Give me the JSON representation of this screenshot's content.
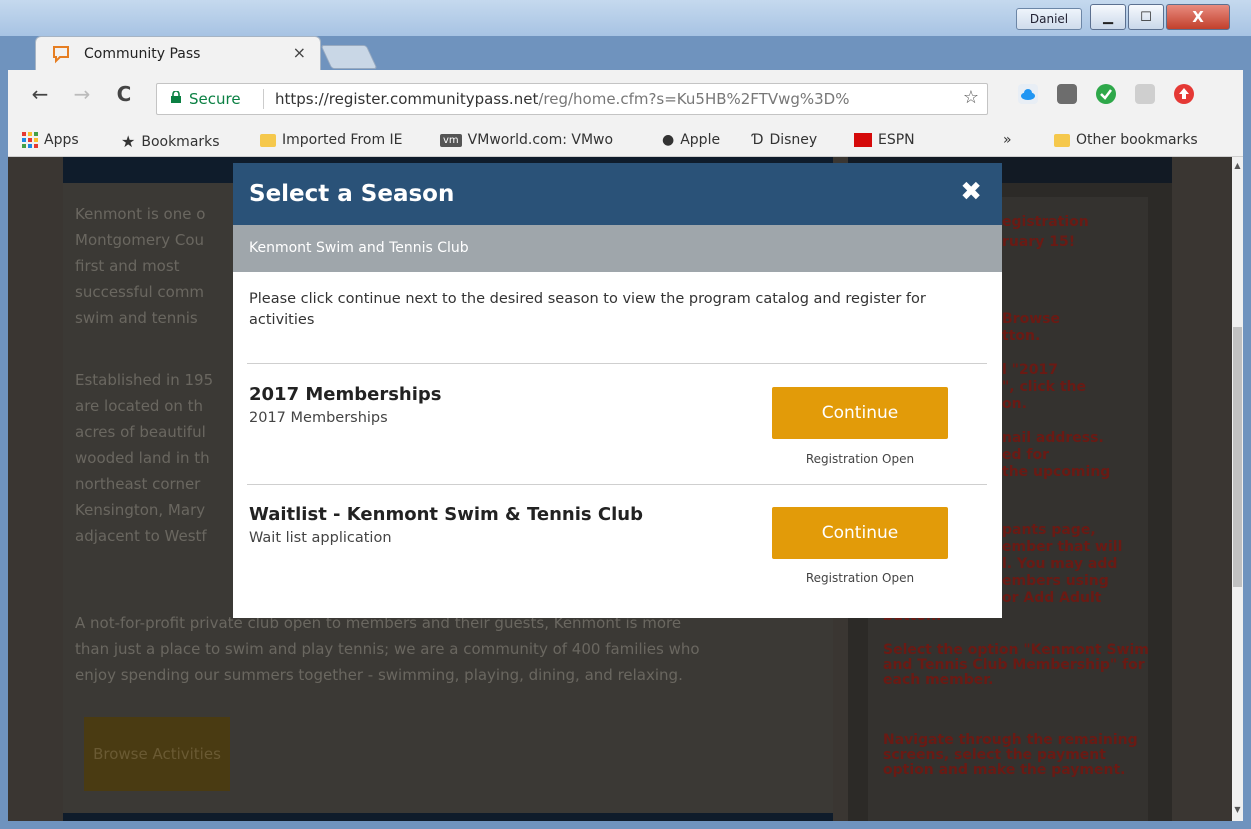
{
  "window": {
    "user": "Daniel",
    "controls": {
      "minimize": "▁",
      "maximize": "☐",
      "close": "X"
    }
  },
  "tab": {
    "title": "Community Pass",
    "close": "×"
  },
  "toolbar": {
    "back": "←",
    "forward": "→",
    "reload": "C",
    "secure": "Secure",
    "url_host": "https://register.communitypass.net",
    "url_path": "/reg/home.cfm?s=Ku5HB%2FTVwg%3D%",
    "star": "☆"
  },
  "bookmarks": {
    "apps": "Apps",
    "items": [
      "Bookmarks",
      "Imported From IE",
      "VMworld.com: VMwo",
      "Apple",
      "Disney",
      "ESPN"
    ],
    "overflow": "»",
    "other": "Other bookmarks"
  },
  "background_page": {
    "para1": [
      "Kenmont is one o",
      "Montgomery Cou",
      "first and most",
      "successful comm",
      "swim and tennis"
    ],
    "para2": [
      "Established in 195",
      "are located on th",
      "acres of beautiful",
      "wooded land in th",
      "northeast corner",
      "Kensington, Mary",
      "adjacent to Westf"
    ],
    "para3": [
      "A not-for-profit private club open to members and their guests, Kenmont is more",
      "than just a place to swim and play tennis; we are a community of 400 families who",
      "enjoy spending our summers together - swimming, playing, dining, and relaxing."
    ],
    "browse_button": "Browse Activities",
    "side_texts": [
      "egistration",
      "ruary 15!",
      "Browse",
      "tton.",
      "l \"2017",
      "\", click the",
      "on.",
      "nail address.",
      "ed for",
      "the upcoming",
      "pants page,",
      "ember that will",
      "l. You may add",
      "embers using",
      "or Add Adult",
      "button.",
      "Select the option \"Kenmont Swim and Tennis Club Membership\" for each member.",
      "Navigate through the remaining screens, select the payment option and make the payment."
    ]
  },
  "modal": {
    "title": "Select a Season",
    "close": "✖",
    "org": "Kenmont Swim and Tennis Club",
    "intro": "Please click continue next to the desired season to view the program catalog and register for activities",
    "seasons": [
      {
        "name": "2017 Memberships",
        "description": "2017 Memberships",
        "button": "Continue",
        "status": "Registration Open"
      },
      {
        "name": "Waitlist - Kenmont Swim & Tennis Club",
        "description": "Wait list application",
        "button": "Continue",
        "status": "Registration Open"
      }
    ]
  }
}
